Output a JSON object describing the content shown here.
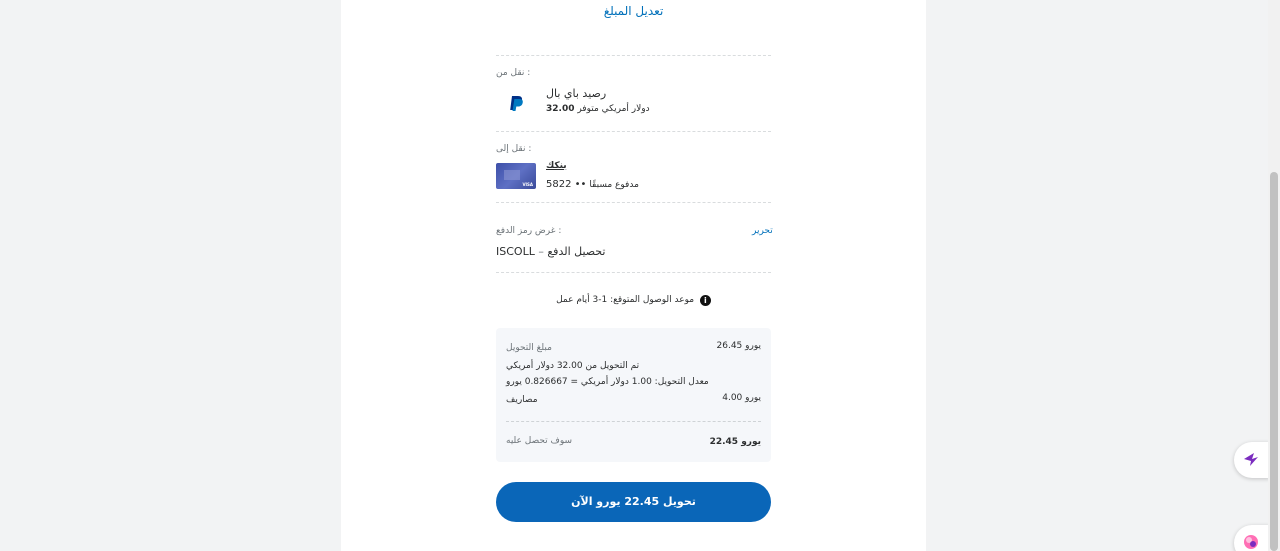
{
  "colors": {
    "accent": "#0070ba",
    "button": "#0a66b8",
    "summary_bg": "#f5f7fa",
    "extension": "#7b2cbf"
  },
  "header": {
    "edit_amount_link": "تعديل المبلغ"
  },
  "from": {
    "label": ": نقل من",
    "icon": "paypal-icon",
    "name": "رصيد باي بال",
    "detail_text": "دولار أمريكي متوفر",
    "amount": "32.00"
  },
  "to": {
    "label": ": نقل إلى",
    "icon": "visa-card-icon",
    "name": "بنكك",
    "detail_text": "مدفوع مسبقًا",
    "digits": "5822 ••"
  },
  "purpose": {
    "label": ": غرض رمز الدفع",
    "edit": "تحرير",
    "code": "ISCOLL",
    "dash": "–",
    "text": "تحصيل الدفع"
  },
  "eta": {
    "text": "موعد الوصول المتوقع: 1-3 أيام عمل",
    "icon": "info-icon"
  },
  "summary": {
    "conversion_amount_label": "مبلغ التحويل",
    "conversion_amount_value": "يورو 26.45",
    "converted_from": "تم التحويل من 32.00 دولار أمريكي",
    "rate": "معدل التحويل: 1.00 دولار أمريكي = 0.826667 يورو",
    "fees_label": "مصاريف",
    "fees_value": "يورو 4.00",
    "receive_label": "سوف تحصل عليه",
    "receive_value": "يورو 22.45"
  },
  "cta": {
    "label": "تحويل 22.45 يورو الآن"
  }
}
